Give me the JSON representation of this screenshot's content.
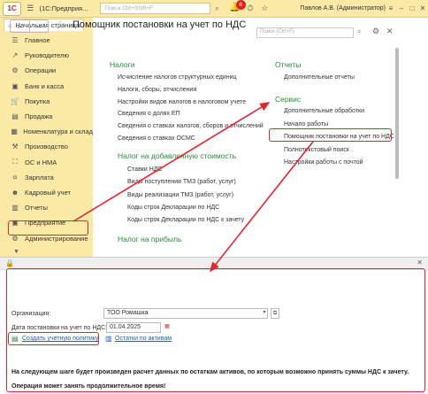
{
  "app": {
    "logo": "1С",
    "title": "(1С:Предприя...",
    "search_placeholder": "Поиск Ctrl+Shift+F",
    "notifications": "6",
    "user": "Павлов А.В. (Администратор)"
  },
  "tabs": {
    "home": "Начальная страница"
  },
  "sidebar": {
    "items": [
      {
        "icon": "menu-icon",
        "label": "Главное"
      },
      {
        "icon": "chart-icon",
        "label": "Руководителю"
      },
      {
        "icon": "operations-icon",
        "label": "Операции"
      },
      {
        "icon": "bank-icon",
        "label": "Банк и касса"
      },
      {
        "icon": "cart-icon",
        "label": "Покупка"
      },
      {
        "icon": "sale-icon",
        "label": "Продажа"
      },
      {
        "icon": "warehouse-icon",
        "label": "Номенклатура и склад"
      },
      {
        "icon": "production-icon",
        "label": "Производство"
      },
      {
        "icon": "assets-icon",
        "label": "ОС и НМА"
      },
      {
        "icon": "salary-icon",
        "label": "Зарплата"
      },
      {
        "icon": "hr-icon",
        "label": "Кадровый учет"
      },
      {
        "icon": "reports-icon",
        "label": "Отчеты"
      },
      {
        "icon": "enterprise-icon",
        "label": "Предприятие"
      },
      {
        "icon": "admin-icon",
        "label": "Администрирование"
      }
    ]
  },
  "panel": {
    "search_placeholder": "Поиск (Ctrl+F)",
    "taxes": {
      "title": "Налоги",
      "links": [
        "Исчисление налогов структурных единиц",
        "Налоги, сборы, отчисления",
        "Настройки видов налогов в налоговом учете",
        "Сведения о долях ЕП",
        "Сведения о ставках налогов, сборов и отчислений",
        "Сведения о ставках ОСМС"
      ]
    },
    "vat": {
      "title": "Налог на добавленную стоимость",
      "links": [
        "Ставки НДС",
        "Виды поступления ТМЗ (работ, услуг)",
        "Виды реализации ТМЗ (работ, услуг)",
        "Коды строк Декларации по НДС",
        "Коды строк Декларации по НДС к зачету"
      ]
    },
    "profit": {
      "title": "Налог на прибыль"
    },
    "reports": {
      "title": "Отчеты",
      "links": [
        "Дополнительные отчеты"
      ]
    },
    "service": {
      "title": "Сервис",
      "links": [
        "Дополнительные обработки",
        "Начало работы",
        "Помощник постановки на учет по НДС",
        "Полнотекстовый поиск",
        "Настройки работы с почтой"
      ]
    }
  },
  "form": {
    "title": "Помощник постановки на учет по НДС",
    "org_label": "Организация:",
    "org_value": "ТОО Ромашка",
    "date_label": "Дата постановки на учет по НДС:",
    "date_value": "01.04.2025",
    "create_policy": "Создать учетную политику",
    "assets_link": "Остатки по активам",
    "note1": "На следующем шаге будет произведен расчет данных по остаткам активов, по которым возможно принять суммы НДС к зачету.",
    "note2": "Операция может занять продолжительное время!"
  },
  "colors": {
    "accent": "#fbe9a6",
    "section": "#2b8a3e",
    "highlight": "#e0262f",
    "link": "#1a5fb4"
  }
}
